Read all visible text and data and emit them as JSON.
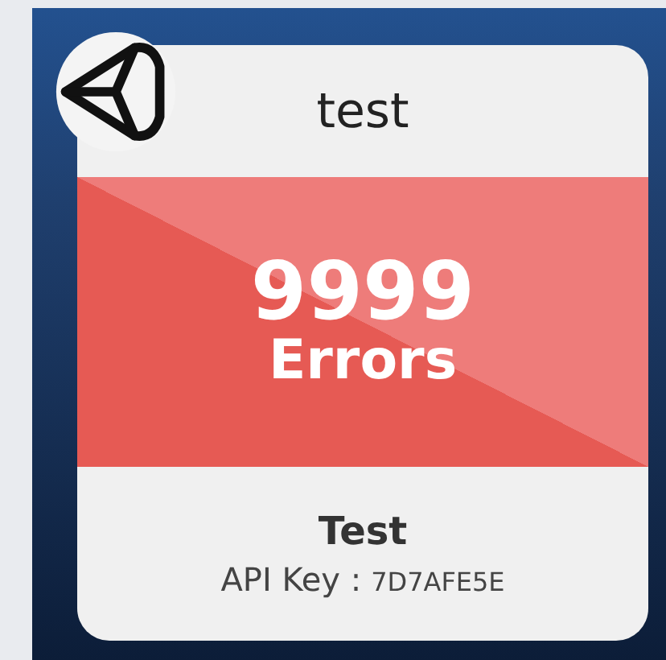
{
  "card": {
    "title": "test",
    "error_count": "9999",
    "error_label": "Errors",
    "project_name": "Test",
    "api_key_label": "API Key :",
    "api_key": "7D7AFE5E"
  }
}
